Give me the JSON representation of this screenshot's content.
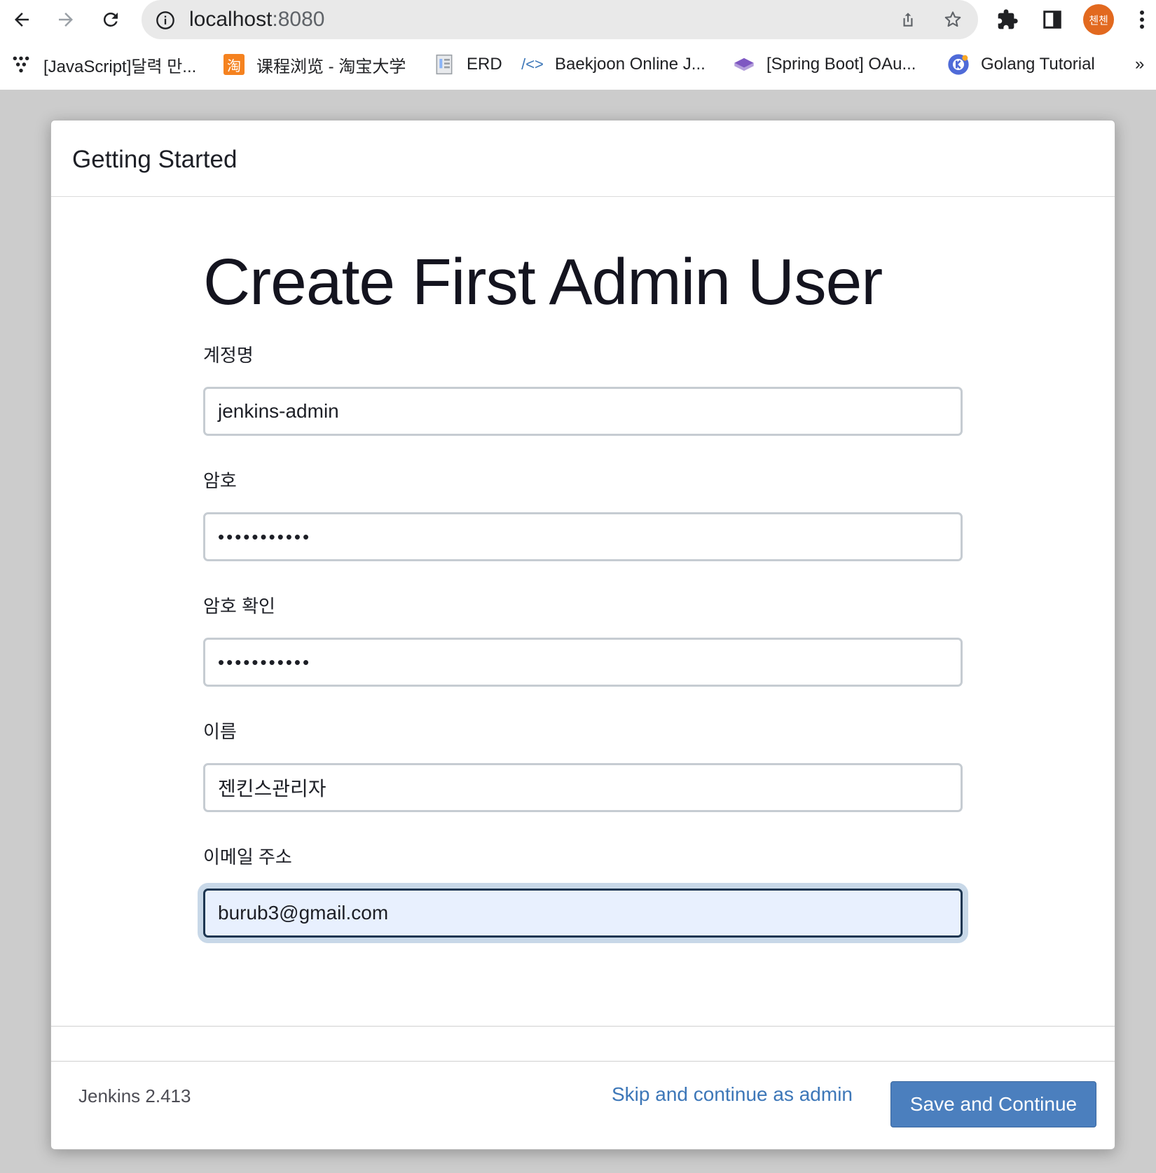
{
  "browser": {
    "url_host": "localhost",
    "url_port": ":8080",
    "profile_initials": "첸첸",
    "bookmarks": [
      {
        "label": "[JavaScript]달력 만...",
        "icon": "dots-icon"
      },
      {
        "label": "课程浏览 - 淘宝大学",
        "icon": "taobao-icon",
        "icon_text": "淘"
      },
      {
        "label": "ERD",
        "icon": "document-icon"
      },
      {
        "label": "Baekjoon Online J...",
        "icon": "code-brackets-icon",
        "icon_text": "/<>"
      },
      {
        "label": "[Spring Boot] OAu...",
        "icon": "book-icon"
      },
      {
        "label": "Golang Tutorial",
        "icon": "golang-icon"
      }
    ],
    "overflow": "»"
  },
  "dialog": {
    "header_title": "Getting Started",
    "page_title": "Create First Admin User",
    "fields": [
      {
        "label": "계정명",
        "value": "jenkins-admin",
        "type": "text"
      },
      {
        "label": "암호",
        "value": "•••••••••••",
        "type": "password"
      },
      {
        "label": "암호 확인",
        "value": "•••••••••••",
        "type": "password"
      },
      {
        "label": "이름",
        "value": "젠킨스관리자",
        "type": "text"
      },
      {
        "label": "이메일 주소",
        "value": "burub3@gmail.com",
        "type": "email",
        "focused": true
      }
    ],
    "footer": {
      "version": "Jenkins 2.413",
      "skip_label": "Skip and continue as admin",
      "save_label": "Save and Continue"
    }
  },
  "colors": {
    "accent": "#4b7fbe",
    "link": "#3d77b8",
    "focus_border": "#1d3651",
    "focus_fill": "#e8f0fe",
    "avatar": "#e2691f"
  }
}
